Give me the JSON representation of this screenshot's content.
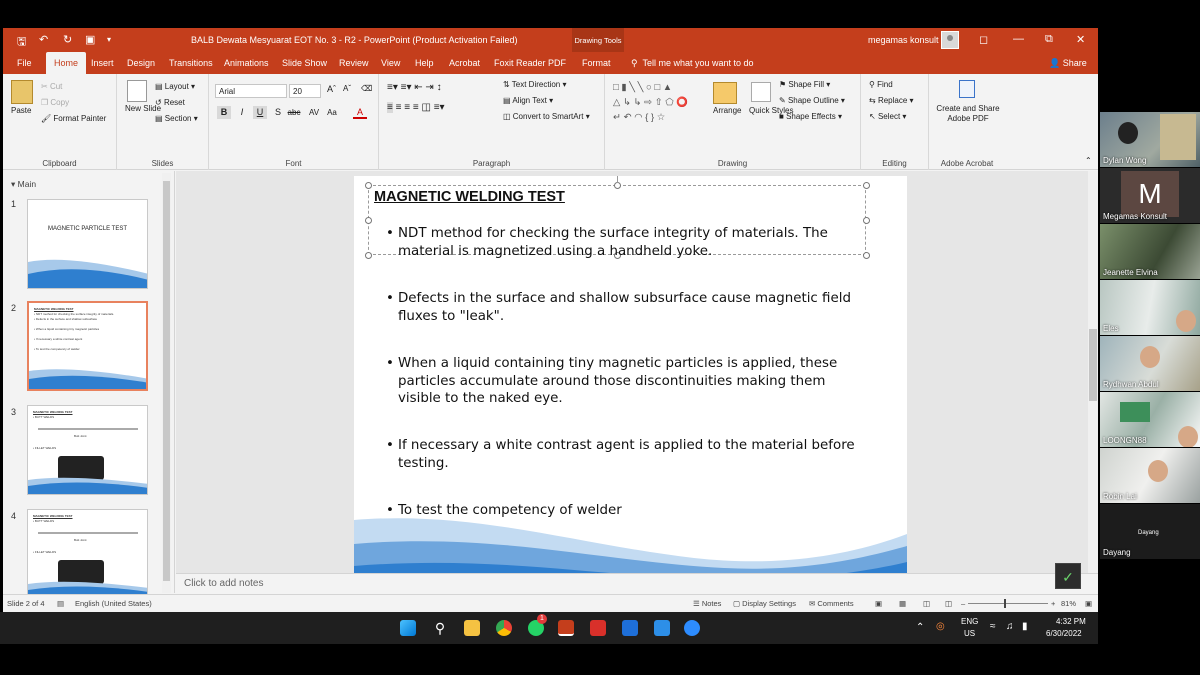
{
  "window": {
    "title": "BALB Dewata Mesyuarat EOT No. 3 - R2  -  PowerPoint (Product Activation Failed)",
    "drawing_tools": "Drawing Tools",
    "user": "megamas konsult"
  },
  "tabs": [
    "File",
    "Home",
    "Insert",
    "Design",
    "Transitions",
    "Animations",
    "Slide Show",
    "Review",
    "View",
    "Help",
    "Acrobat",
    "Foxit Reader PDF",
    "Format"
  ],
  "tell_me": "Tell me what you want to do",
  "share": "Share",
  "ribbon": {
    "clipboard": {
      "label": "Clipboard",
      "paste": "Paste",
      "cut": "Cut",
      "copy": "Copy",
      "format_painter": "Format Painter"
    },
    "slides": {
      "label": "Slides",
      "new_slide": "New Slide",
      "layout": "Layout",
      "reset": "Reset",
      "section": "Section"
    },
    "font": {
      "label": "Font",
      "font_name": "Arial",
      "font_size": "20"
    },
    "paragraph": {
      "label": "Paragraph",
      "text_direction": "Text Direction",
      "align_text": "Align Text",
      "convert_smartart": "Convert to SmartArt"
    },
    "drawing": {
      "label": "Drawing",
      "arrange": "Arrange",
      "quick_styles": "Quick Styles",
      "shape_fill": "Shape Fill",
      "shape_outline": "Shape Outline",
      "shape_effects": "Shape Effects"
    },
    "editing": {
      "label": "Editing",
      "find": "Find",
      "replace": "Replace",
      "select": "Select"
    },
    "adobe": {
      "label": "Adobe Acrobat",
      "create_share": "Create and Share Adobe PDF"
    }
  },
  "thumbnails": {
    "section": "Main",
    "slides": [
      {
        "num": "1",
        "title": "MAGNETIC PARTICLE TEST"
      },
      {
        "num": "2",
        "title": "MAGNETIC WELDING TEST"
      },
      {
        "num": "3",
        "title": "MAGNETIC WELDING TEST",
        "sub1": "BUTT WELDS",
        "sub2": "FILLET WELDS",
        "cap": "Butt Joint"
      },
      {
        "num": "4",
        "title": "MAGNETIC WELDING TEST",
        "sub1": "BUTT WELDS",
        "sub2": "FILLET WELDS",
        "cap": "Butt Joint"
      }
    ]
  },
  "slide": {
    "heading": "MAGNETIC WELDING TEST",
    "bullets": [
      "NDT method for checking the surface integrity of materials. The material is magnetized using a handheld yoke.",
      "Defects in the surface and shallow subsurface cause magnetic field fluxes to \"leak\".",
      "When a liquid containing tiny magnetic particles is applied, these particles accumulate around those discontinuities making them visible to the naked eye.",
      "If necessary a white contrast agent is applied to the material before testing.",
      "To test the competency of welder"
    ]
  },
  "notes_placeholder": "Click to add notes",
  "status": {
    "slide": "Slide 2 of 4",
    "language": "English (United States)",
    "notes": "Notes",
    "display_settings": "Display Settings",
    "comments": "Comments",
    "zoom": "81%"
  },
  "participants": [
    "Dylan Wong",
    "Megamas Konsult",
    "Jeanette Elvina",
    "Eles",
    "Rydhwan Abdul",
    "LOONGN88",
    "Robin Lai",
    "Dayang"
  ],
  "participant_initial": "M",
  "taskbar": {
    "lang": "ENG",
    "region": "US",
    "time": "4:32 PM",
    "date": "6/30/2022",
    "whatsapp_badge": "1"
  },
  "colors": {
    "ppt_red": "#c43e1c",
    "wave_blue": "#2f7fcf",
    "wave_light": "#a7c9ea"
  }
}
